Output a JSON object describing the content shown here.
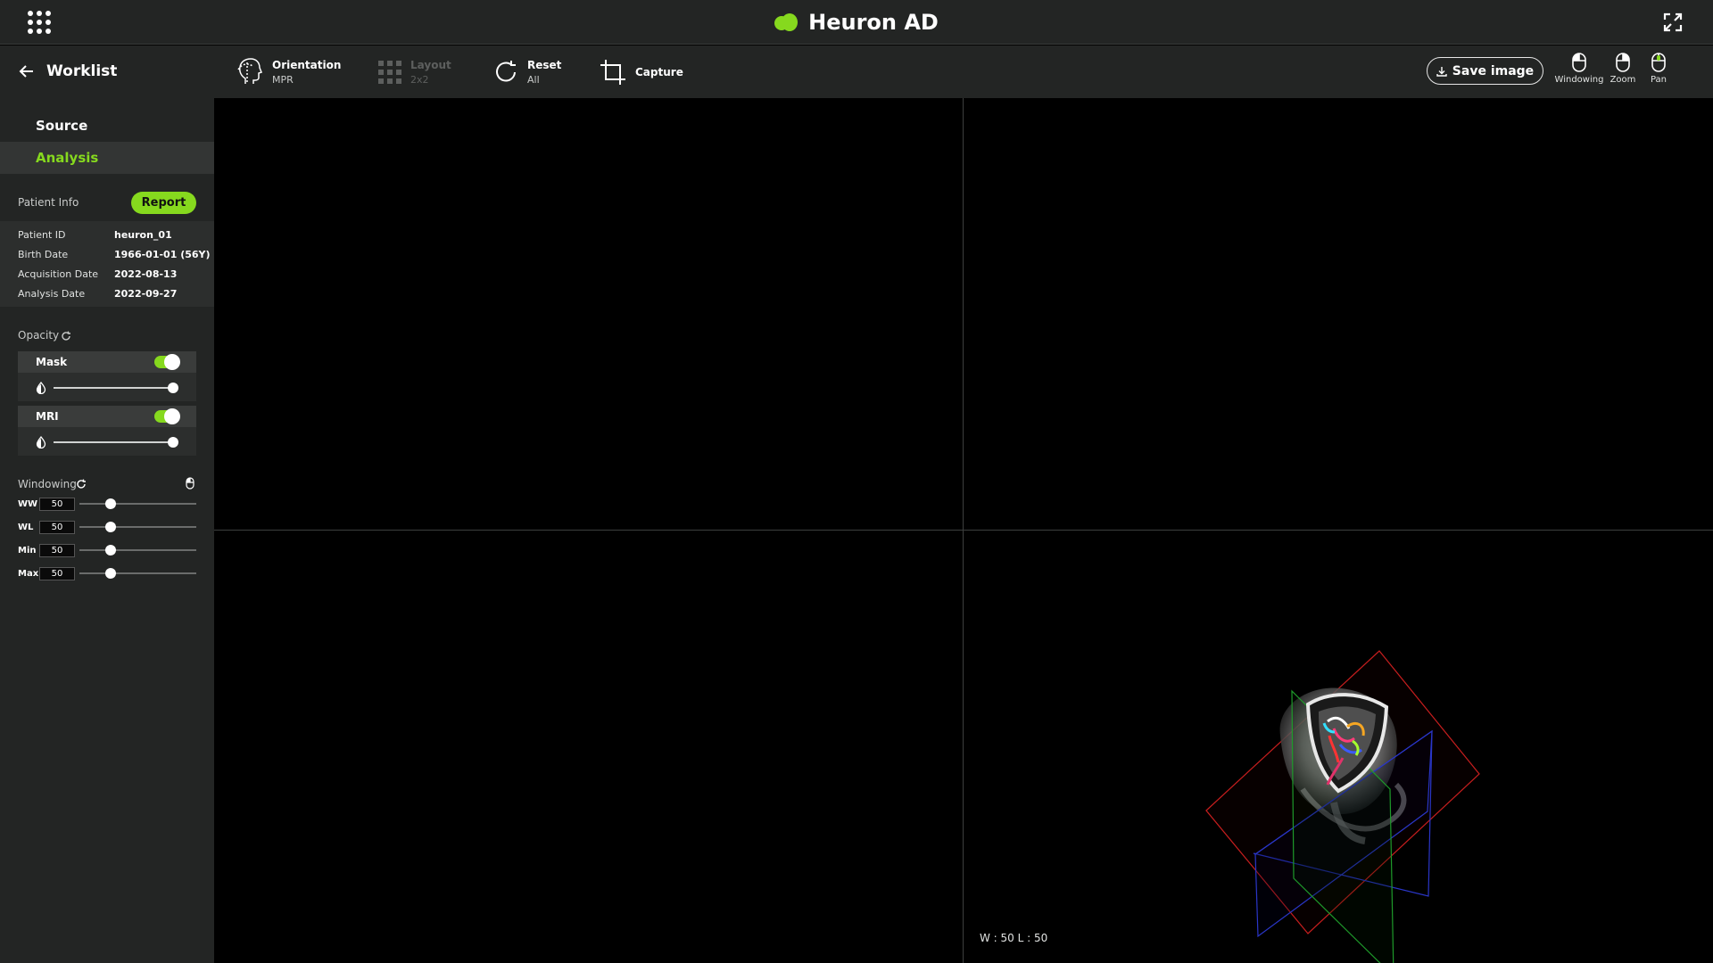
{
  "app": {
    "title": "Heuron AD"
  },
  "sidebar": {
    "back_label": "Worklist",
    "nav": [
      {
        "label": "Source"
      },
      {
        "label": "Analysis"
      }
    ],
    "patient_info": {
      "section_label": "Patient Info",
      "report_label": "Report",
      "rows": [
        {
          "key": "Patient  ID",
          "value": "heuron_01"
        },
        {
          "key": "Birth Date",
          "value": "1966-01-01 (56Y)"
        },
        {
          "key": "Acquisition Date",
          "value": "2022-08-13"
        },
        {
          "key": "Analysis Date",
          "value": "2022-09-27"
        }
      ]
    },
    "opacity": {
      "section_label": "Opacity",
      "layers": [
        {
          "label": "Mask",
          "enabled": true,
          "value": 1.0
        },
        {
          "label": "MRI",
          "enabled": true,
          "value": 1.0
        }
      ]
    },
    "windowing": {
      "section_label": "Windowing",
      "rows": [
        {
          "label": "WW",
          "value": "50",
          "slider": 0.27
        },
        {
          "label": "WL",
          "value": "50",
          "slider": 0.27
        },
        {
          "label": "Min",
          "value": "50",
          "slider": 0.27
        },
        {
          "label": "Max",
          "value": "50",
          "slider": 0.27
        }
      ]
    }
  },
  "toolbar": {
    "orientation": {
      "title": "Orientation",
      "sub": "MPR"
    },
    "layout": {
      "title": "Layout",
      "sub": "2x2"
    },
    "reset": {
      "title": "Reset",
      "sub": "All"
    },
    "capture": {
      "title": "Capture"
    },
    "save_label": "Save image",
    "mouse_tools": [
      {
        "label": "Windowing"
      },
      {
        "label": "Zoom"
      },
      {
        "label": "Pan"
      }
    ]
  },
  "viewport_3d": {
    "readout": "W : 50   L : 50"
  },
  "colors": {
    "accent": "#86d91e",
    "panel": "#232524"
  }
}
